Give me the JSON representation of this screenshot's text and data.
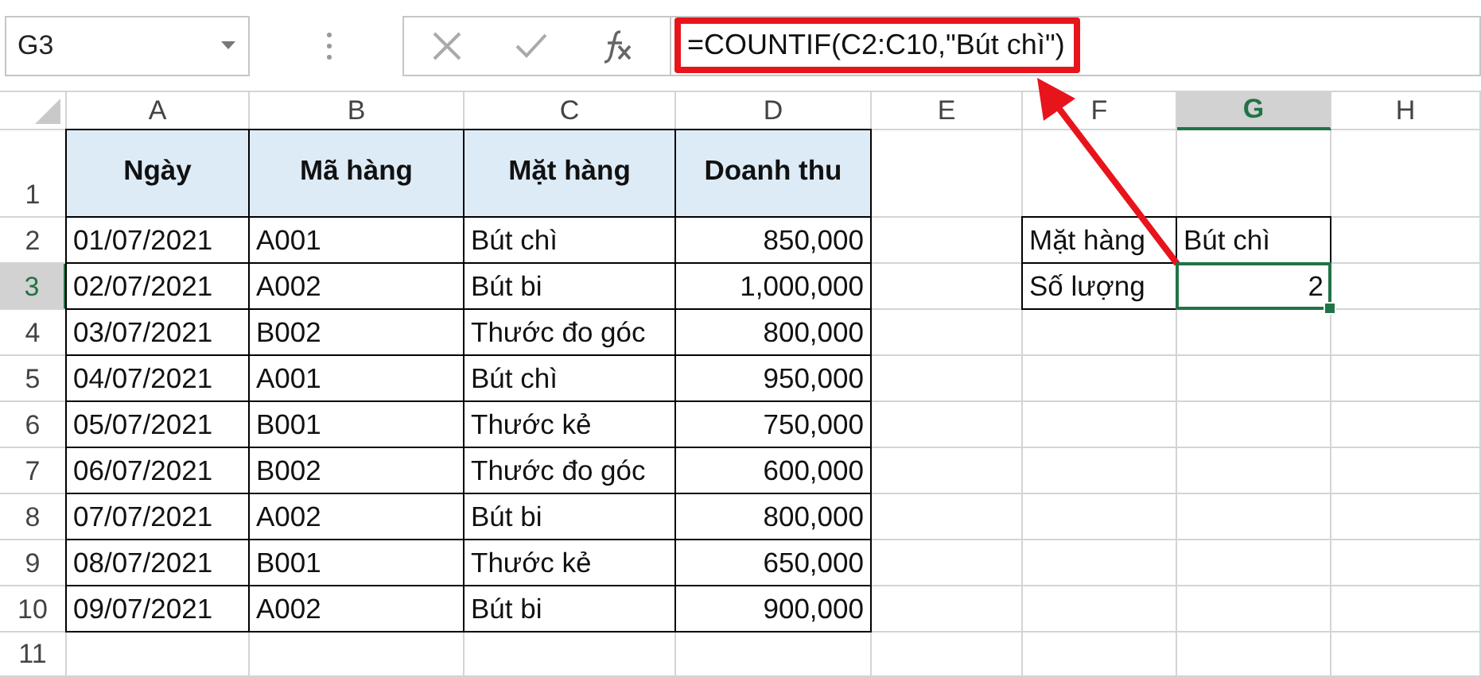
{
  "name_box": "G3",
  "formula": "=COUNTIF(C2:C10,\"Bút chì\")",
  "columns": [
    {
      "label": "A",
      "selected": false
    },
    {
      "label": "B",
      "selected": false
    },
    {
      "label": "C",
      "selected": false
    },
    {
      "label": "D",
      "selected": false
    },
    {
      "label": "E",
      "selected": false
    },
    {
      "label": "F",
      "selected": false
    },
    {
      "label": "G",
      "selected": true
    },
    {
      "label": "H",
      "selected": false
    }
  ],
  "rows": [
    {
      "label": "1",
      "selected": false
    },
    {
      "label": "2",
      "selected": false
    },
    {
      "label": "3",
      "selected": true
    },
    {
      "label": "4",
      "selected": false
    },
    {
      "label": "5",
      "selected": false
    },
    {
      "label": "6",
      "selected": false
    },
    {
      "label": "7",
      "selected": false
    },
    {
      "label": "8",
      "selected": false
    },
    {
      "label": "9",
      "selected": false
    },
    {
      "label": "10",
      "selected": false
    },
    {
      "label": "11",
      "selected": false
    }
  ],
  "sales_table": {
    "headers": [
      "Ngày",
      "Mã hàng",
      "Mặt hàng",
      "Doanh thu"
    ],
    "rows": [
      [
        "01/07/2021",
        "A001",
        "Bút chì",
        "850,000"
      ],
      [
        "02/07/2021",
        "A002",
        "Bút bi",
        "1,000,000"
      ],
      [
        "03/07/2021",
        "B002",
        "Thước đo góc",
        "800,000"
      ],
      [
        "04/07/2021",
        "A001",
        "Bút chì",
        "950,000"
      ],
      [
        "05/07/2021",
        "B001",
        "Thước kẻ",
        "750,000"
      ],
      [
        "06/07/2021",
        "B002",
        "Thước đo góc",
        "600,000"
      ],
      [
        "07/07/2021",
        "A002",
        "Bút bi",
        "800,000"
      ],
      [
        "08/07/2021",
        "B001",
        "Thước kẻ",
        "650,000"
      ],
      [
        "09/07/2021",
        "A002",
        "Bút bi",
        "900,000"
      ]
    ]
  },
  "lookup_table": {
    "rows": [
      {
        "label": "Mặt hàng",
        "value": "Bút chì",
        "selected": false
      },
      {
        "label": "Số lượng",
        "value": "2",
        "selected": true
      }
    ]
  }
}
